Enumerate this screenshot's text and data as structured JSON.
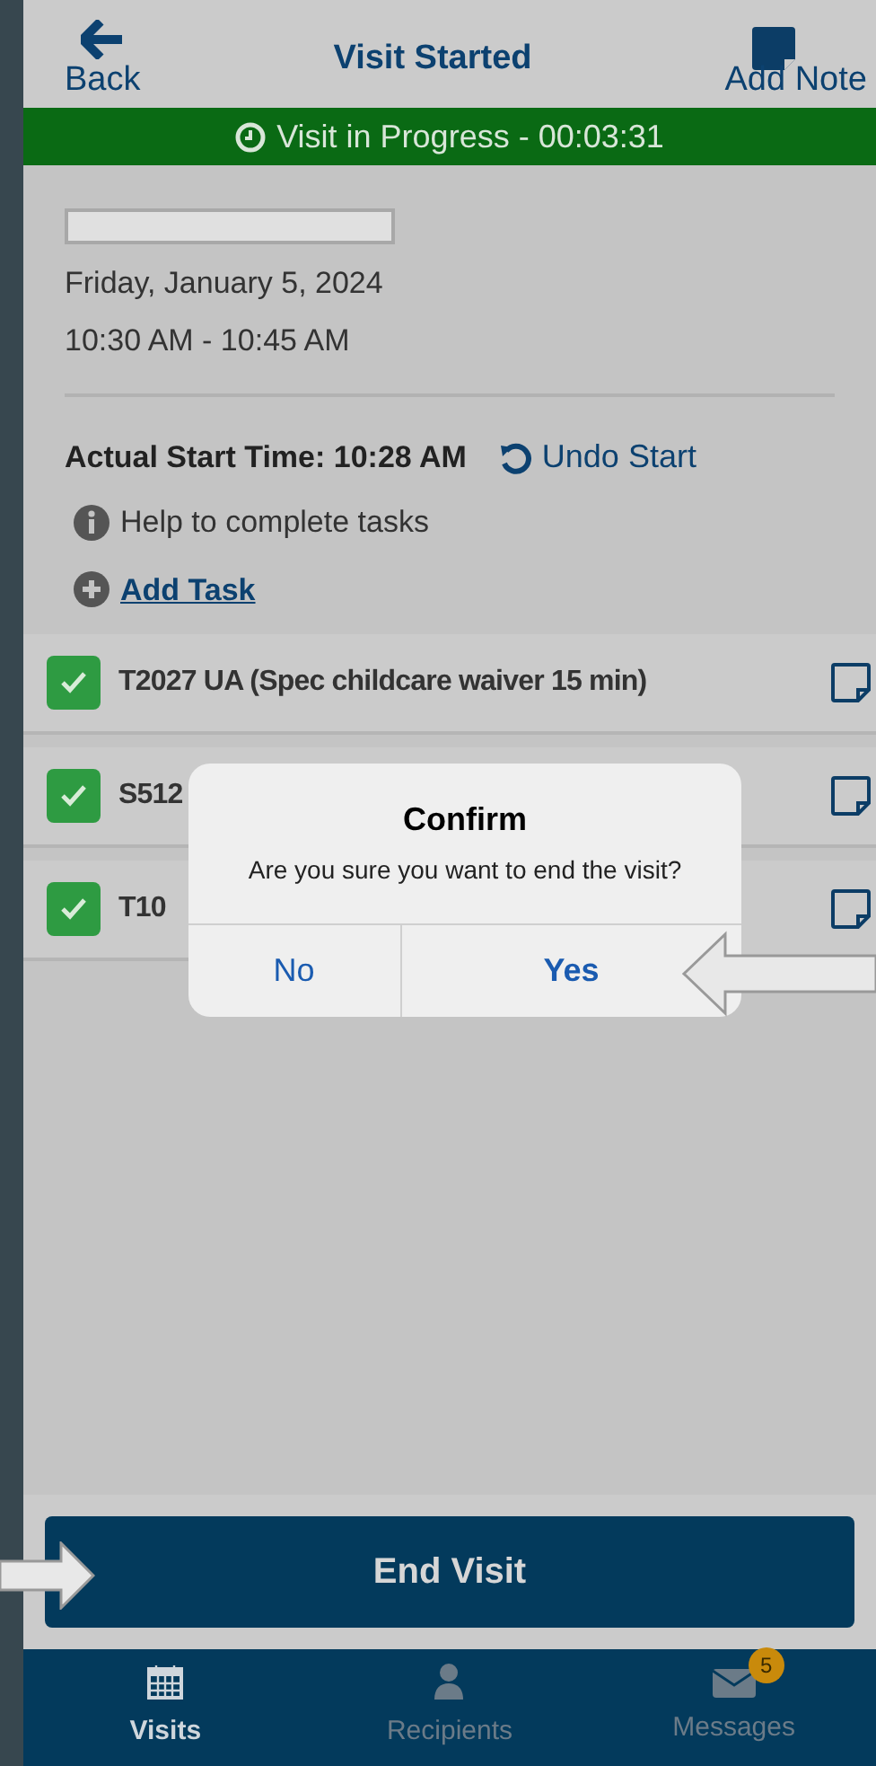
{
  "header": {
    "back": "Back",
    "title": "Visit Started",
    "add_note": "Add Note"
  },
  "status_banner": "Visit in Progress - 00:03:31",
  "visit": {
    "date": "Friday, January 5, 2024",
    "time": "10:30 AM - 10:45 AM",
    "actual_start": "Actual Start Time: 10:28 AM",
    "undo": "Undo Start",
    "help": "Help to complete tasks",
    "add_task": "Add Task"
  },
  "tasks": [
    {
      "label": "T2027 UA (Spec childcare waiver 15 min)",
      "checked": true
    },
    {
      "label": "S512",
      "checked": true
    },
    {
      "label": "T10",
      "checked": true
    }
  ],
  "dialog": {
    "title": "Confirm",
    "message": "Are you sure you want to end the visit?",
    "buttons": [
      {
        "label": "No"
      },
      {
        "label": "Yes"
      }
    ]
  },
  "end_button": "End Visit",
  "tab_bar": [
    {
      "label": "Visits",
      "selected": true
    },
    {
      "label": "Recipients",
      "selected": false
    },
    {
      "label": "Messages",
      "selected": false,
      "badge": "5"
    }
  ]
}
